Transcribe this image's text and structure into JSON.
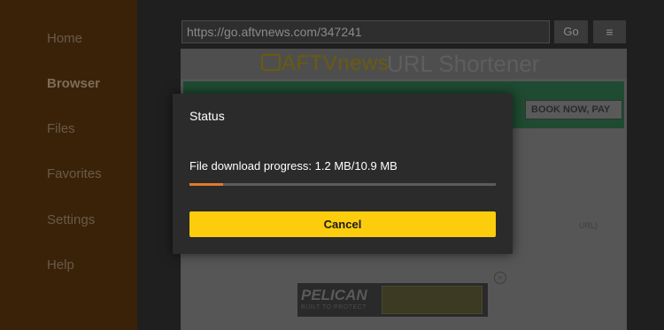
{
  "sidebar": {
    "items": [
      {
        "label": "Home"
      },
      {
        "label": "Browser"
      },
      {
        "label": "Files"
      },
      {
        "label": "Favorites"
      },
      {
        "label": "Settings"
      },
      {
        "label": "Help"
      }
    ]
  },
  "browser": {
    "url": "https://go.aftvnews.com/347241",
    "go_label": "Go",
    "menu_icon": "≡"
  },
  "webpage": {
    "logo_text": "AFTVnews",
    "title": "URL Shortener",
    "banner_button": "BOOK NOW, PAY",
    "url_hint": "URL)",
    "ad_brand": "PELICAN",
    "ad_tagline": "BUILT TO PROTECT",
    "ad_close": "×"
  },
  "dialog": {
    "title": "Status",
    "message": "File download progress: 1.2 MB/10.9 MB",
    "progress_fraction": 0.11,
    "cancel_label": "Cancel"
  },
  "colors": {
    "sidebar_bg": "#3a2208",
    "accent_progress": "#e07a2c",
    "cancel_button": "#fccd0c",
    "dialog_bg": "#2b2b2b"
  }
}
